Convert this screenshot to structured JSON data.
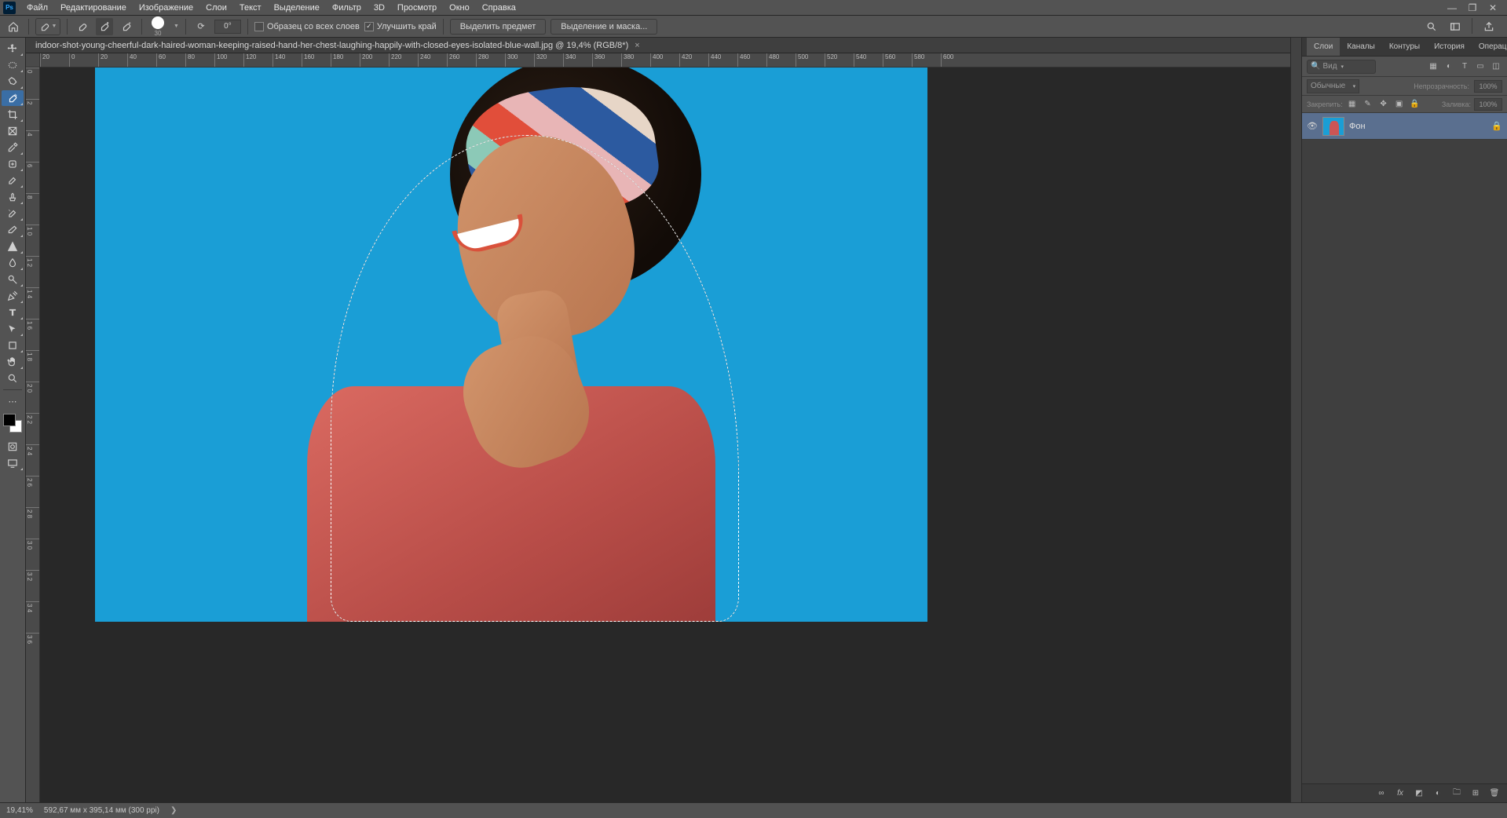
{
  "menu": {
    "items": [
      "Файл",
      "Редактирование",
      "Изображение",
      "Слои",
      "Текст",
      "Выделение",
      "Фильтр",
      "3D",
      "Просмотр",
      "Окно",
      "Справка"
    ]
  },
  "options": {
    "brush_size": "30",
    "angle": "0°",
    "sample_all_label": "Образец со всех слоев",
    "refine_edge_label": "Улучшить край",
    "select_subject_label": "Выделить предмет",
    "select_mask_label": "Выделение и маска..."
  },
  "document": {
    "tab_title": "indoor-shot-young-cheerful-dark-haired-woman-keeping-raised-hand-her-chest-laughing-happily-with-closed-eyes-isolated-blue-wall.jpg @ 19,4% (RGB/8*)"
  },
  "ruler_h": [
    "20",
    "0",
    "20",
    "40",
    "60",
    "80",
    "100",
    "120",
    "140",
    "160",
    "180",
    "200",
    "220",
    "240",
    "260",
    "280",
    "300",
    "320",
    "340",
    "360",
    "380",
    "400",
    "420",
    "440",
    "460",
    "480",
    "500",
    "520",
    "540",
    "560",
    "580",
    "600"
  ],
  "ruler_v": [
    "0",
    "2",
    "4",
    "6",
    "8",
    "1\n0",
    "1\n2",
    "1\n4",
    "1\n6",
    "1\n8",
    "2\n0",
    "2\n2",
    "2\n4",
    "2\n6",
    "2\n8",
    "3\n0",
    "3\n2",
    "3\n4",
    "3\n6"
  ],
  "panels": {
    "tabs": [
      "Слои",
      "Каналы",
      "Контуры",
      "История",
      "Операции"
    ],
    "search_placeholder": "Вид",
    "blend_mode": "Обычные",
    "opacity_label": "Непрозрачность:",
    "opacity_value": "100%",
    "lock_label": "Закрепить:",
    "fill_label": "Заливка:",
    "fill_value": "100%",
    "layers": [
      {
        "name": "Фон",
        "locked": true,
        "visible": true
      }
    ]
  },
  "status": {
    "zoom": "19,41%",
    "doc_size": "592,67 мм x 395,14 мм (300 ppi)"
  },
  "colors": {
    "accent": "#3a6ea5",
    "canvas_bg": "#1a9ed6"
  }
}
